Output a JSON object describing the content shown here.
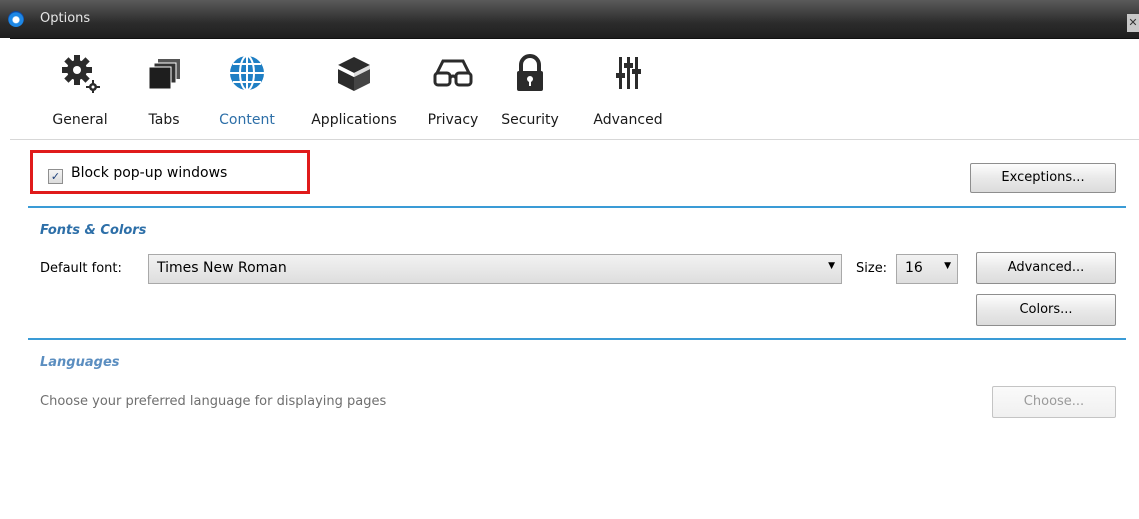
{
  "window": {
    "title": "Options",
    "close_glyph": "✕"
  },
  "tabs": [
    {
      "label": "General",
      "icon": "gear-icon"
    },
    {
      "label": "Tabs",
      "icon": "tabs-icon"
    },
    {
      "label": "Content",
      "icon": "globe-icon",
      "active": true
    },
    {
      "label": "Applications",
      "icon": "box-icon"
    },
    {
      "label": "Privacy",
      "icon": "glasses-icon"
    },
    {
      "label": "Security",
      "icon": "lock-icon"
    },
    {
      "label": "Advanced",
      "icon": "sliders-icon"
    }
  ],
  "popups": {
    "checkbox_label": "Block pop-up windows",
    "checked": true,
    "check_glyph": "✓",
    "exceptions_button": "Exceptions..."
  },
  "fonts_colors": {
    "section_title": "Fonts & Colors",
    "default_font_label": "Default font:",
    "default_font_value": "Times New Roman",
    "size_label": "Size:",
    "size_value": "16",
    "dropdown_glyph": "▼",
    "advanced_button": "Advanced...",
    "colors_button": "Colors..."
  },
  "languages": {
    "section_title": "Languages",
    "description": "Choose your preferred language for displaying pages",
    "choose_button": "Choose..."
  },
  "colors": {
    "accent": "#2d6fa8",
    "separator": "#3a9bd6",
    "highlight_border": "#e01b1b",
    "titlebar": "#2c2c2c"
  }
}
